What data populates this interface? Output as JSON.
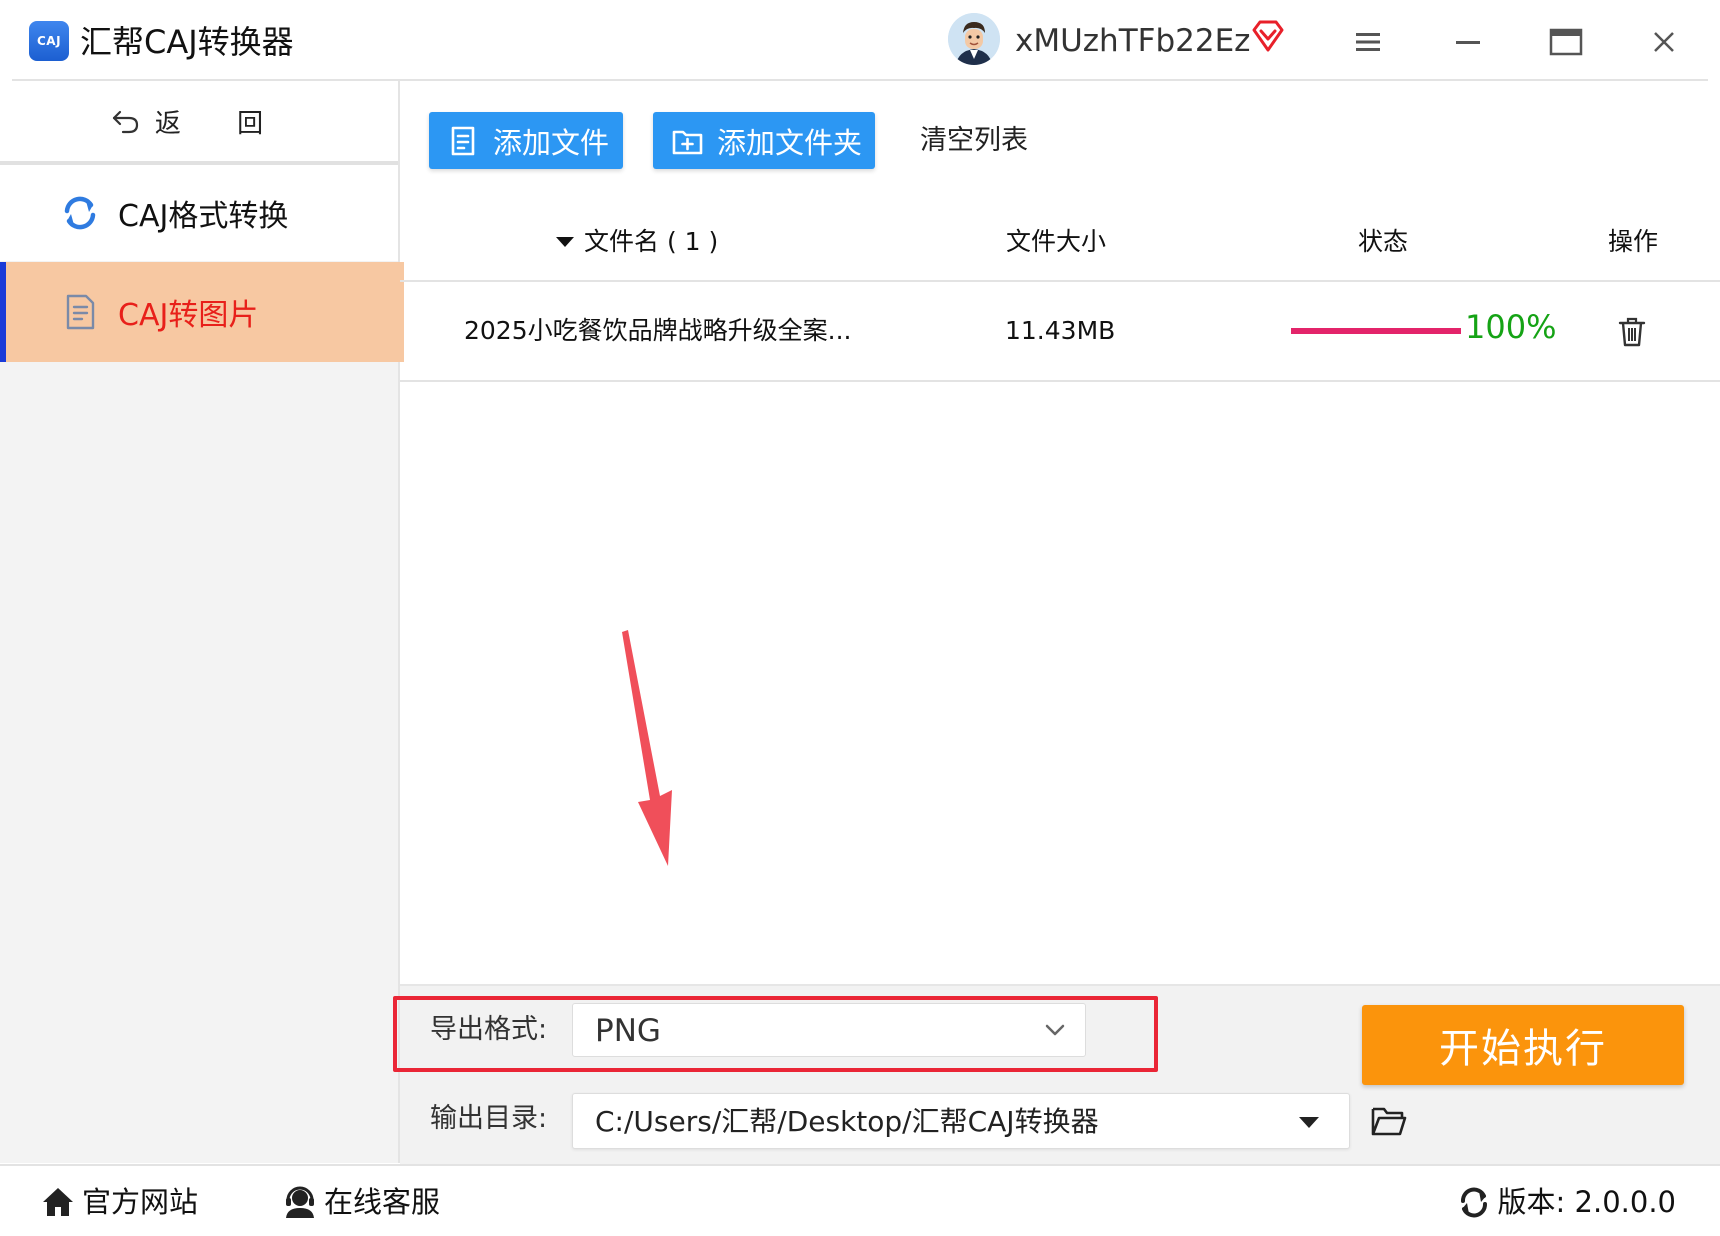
{
  "app": {
    "logo_text": "CAJ",
    "title": "汇帮CAJ转换器",
    "username": "xMUzhTFb22Ez"
  },
  "sidebar": {
    "back_label": "返 回",
    "items": [
      {
        "label": "CAJ格式转换",
        "icon": "refresh-icon",
        "active": false
      },
      {
        "label": "CAJ转图片",
        "icon": "document-icon",
        "active": true
      }
    ]
  },
  "toolbar": {
    "add_file_label": "添加文件",
    "add_folder_label": "添加文件夹",
    "clear_label": "清空列表"
  },
  "table": {
    "headers": {
      "name": "文件名 ( 1 )",
      "size": "文件大小",
      "status": "状态",
      "action": "操作"
    },
    "rows": [
      {
        "name": "2025小吃餐饮品牌战略升级全案...",
        "size": "11.43MB",
        "progress": 1.0,
        "progress_text": "100%"
      }
    ]
  },
  "export": {
    "format_label": "导出格式:",
    "format_value": "PNG",
    "dir_label": "输出目录:",
    "dir_value": "C:/Users/汇帮/Desktop/汇帮CAJ转换器",
    "start_label": "开始执行"
  },
  "footer": {
    "site_label": "官方网站",
    "service_label": "在线客服",
    "version_label": "版本: 2.0.0.0"
  },
  "colors": {
    "primary_button": "#2c97f3",
    "start_button": "#fb940c",
    "active_nav_bg": "#f7c8a2",
    "active_nav_text": "#e8201a",
    "progress": "#e3246a",
    "percent_text": "#15a315",
    "highlight": "#ea2636"
  }
}
